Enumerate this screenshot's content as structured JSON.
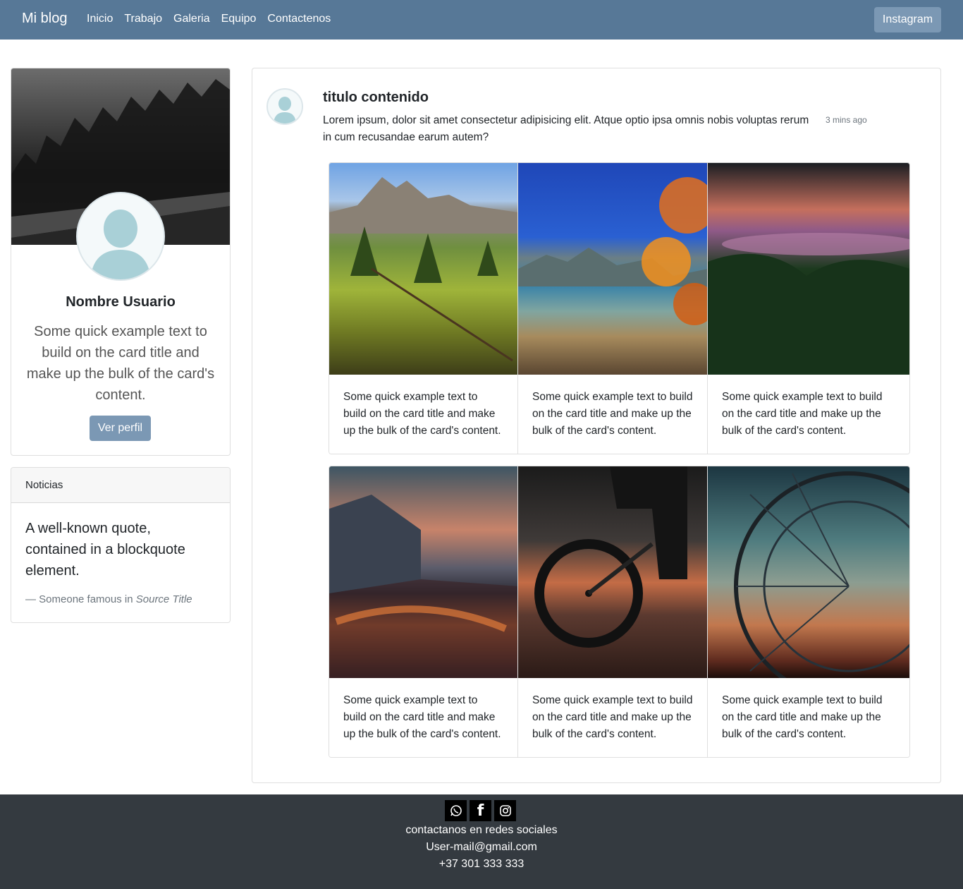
{
  "nav": {
    "brand": "Mi blog",
    "links": [
      "Inicio",
      "Trabajo",
      "Galeria",
      "Equipo",
      "Contactenos"
    ],
    "instagram_label": "Instagram"
  },
  "profile": {
    "name": "Nombre Usuario",
    "text": "Some quick example text to build on the card title and make up the bulk of the card's content.",
    "button_label": "Ver perfil"
  },
  "news": {
    "header": "Noticias",
    "quote": "A well-known quote, contained in a blockquote element.",
    "footer_prefix": "— Someone famous in ",
    "footer_source": "Source Title"
  },
  "post": {
    "title": "titulo contenido",
    "body": "Lorem ipsum, dolor sit amet consectetur adipisicing elit. Atque optio ipsa omnis nobis voluptas rerum in cum recusandae earum autem?",
    "time": "3 mins ago"
  },
  "gallery": {
    "cards": [
      {
        "image": "mountain-meadow-photo",
        "text": "Some quick example text to build on the card title and make up the bulk of the card's content."
      },
      {
        "image": "autumn-lake-photo",
        "text": "Some quick example text to build on the card title and make up the bulk of the card's content."
      },
      {
        "image": "forest-sunset-photo",
        "text": "Some quick example text to build on the card title and make up the bulk of the card's content."
      },
      {
        "image": "city-reflection-photo",
        "text": "Some quick example text to build on the card title and make up the bulk of the card's content."
      },
      {
        "image": "bicycle-puddle-photo",
        "text": "Some quick example text to build on the card title and make up the bulk of the card's content."
      },
      {
        "image": "ferris-wheel-photo",
        "text": "Some quick example text to build on the card title and make up the bulk of the card's content."
      }
    ]
  },
  "footer": {
    "social_icons": [
      "whatsapp-icon",
      "facebook-icon",
      "instagram-icon"
    ],
    "line1": "contactanos en redes sociales",
    "email": "User-mail@gmail.com",
    "phone": "+37 301 333 333"
  },
  "colors": {
    "navbar": "#577897",
    "button": "#7b98b4",
    "footer": "#343a40"
  }
}
